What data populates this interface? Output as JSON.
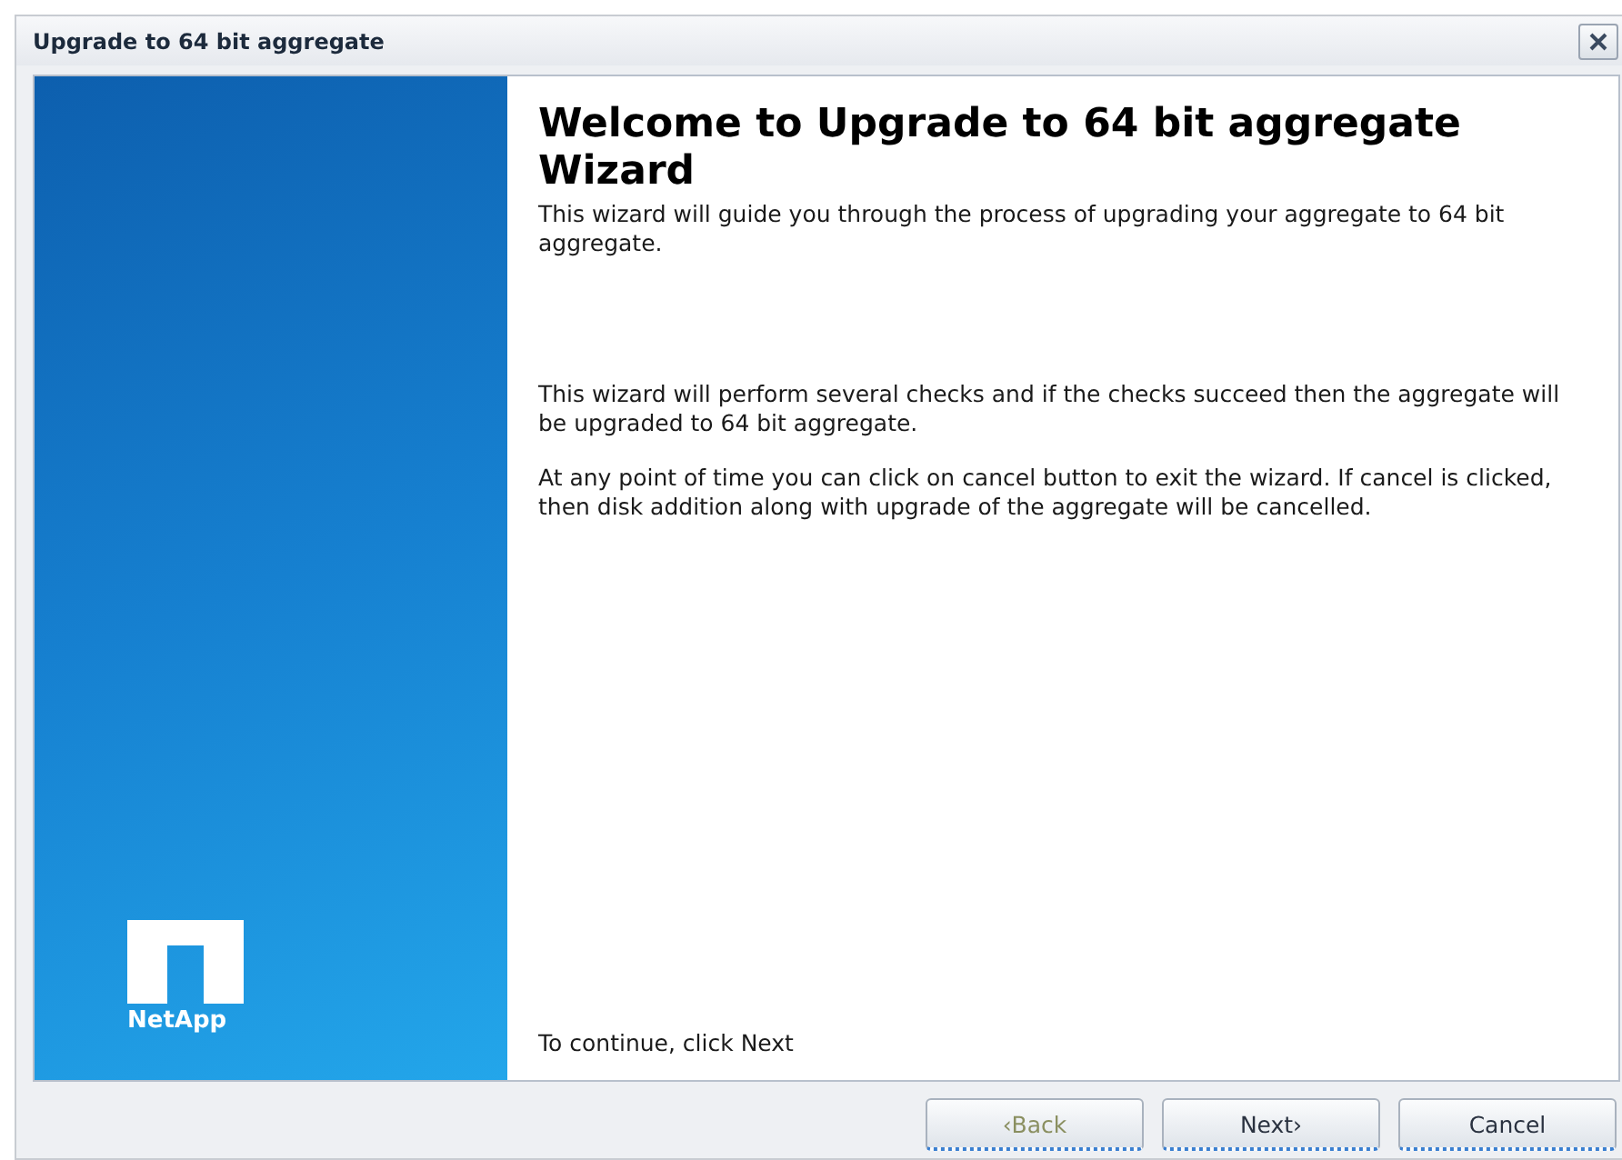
{
  "window": {
    "title": "Upgrade to 64 bit aggregate"
  },
  "sidebar": {
    "brand": "NetApp"
  },
  "content": {
    "heading": "Welcome to Upgrade to 64 bit aggregate Wizard",
    "paragraphs": [
      "This wizard will guide you through the process of upgrading your aggregate to 64 bit aggregate.",
      "This wizard will perform several checks and if the checks succeed then the aggregate will be upgraded to 64 bit aggregate.",
      "At any point of time you can click on cancel button to exit the wizard. If cancel is clicked, then disk addition along with upgrade of the aggregate will be cancelled."
    ],
    "footer": "To continue, click Next"
  },
  "buttons": [
    {
      "label": "‹Back",
      "disabled": true
    },
    {
      "label": "Next›",
      "disabled": false
    },
    {
      "label": "Cancel",
      "disabled": false
    }
  ]
}
